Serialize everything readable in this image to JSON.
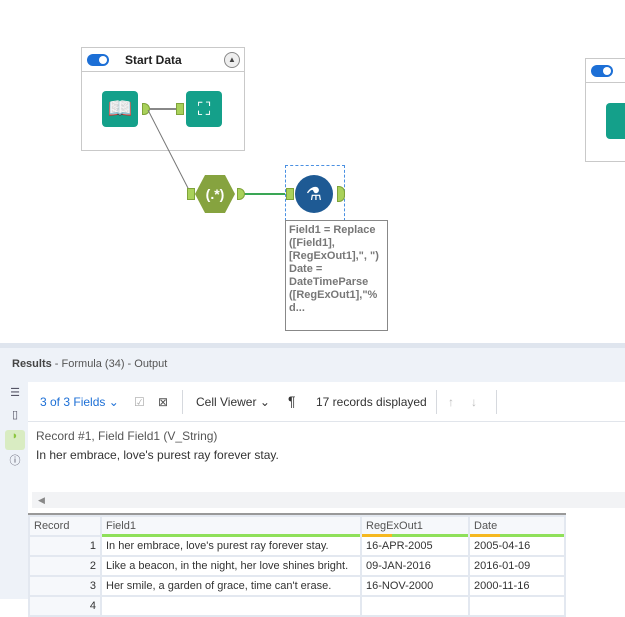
{
  "canvas": {
    "container_title": "Start Data",
    "collapse_icon": "chevron-up-icon",
    "annotation": "Field1 = Replace\n([Field1],\n[RegExOut1],\", \")\nDate =\nDateTimeParse\n([RegExOut1],\"%\nd...",
    "regex_label": "(.*)"
  },
  "results": {
    "title_bold": "Results",
    "title_rest": " - Formula (34) - Output",
    "toolbar": {
      "fields": "3 of 3 Fields",
      "viewer": "Cell Viewer",
      "records": "17 records displayed"
    },
    "cell_viewer": {
      "header": "Record #1, Field Field1 (V_String)",
      "value": "In her embrace, love's purest ray forever stay."
    },
    "columns": [
      "Record",
      "Field1",
      "RegExOut1",
      "Date"
    ],
    "rows": [
      [
        "1",
        "In her embrace, love's purest ray forever stay.",
        "16-APR-2005",
        "2005-04-16"
      ],
      [
        "2",
        "Like a beacon, in the night, her love shines bright.",
        "09-JAN-2016",
        "2016-01-09"
      ],
      [
        "3",
        "Her smile, a garden of grace, time can't erase.",
        "16-NOV-2000",
        "2000-11-16"
      ],
      [
        "4",
        "",
        "",
        ""
      ]
    ]
  },
  "colors": {
    "accent": "#1c6fd6",
    "tool_teal": "#14a08a",
    "regex": "#86a33f",
    "formula": "#1e5a94"
  }
}
